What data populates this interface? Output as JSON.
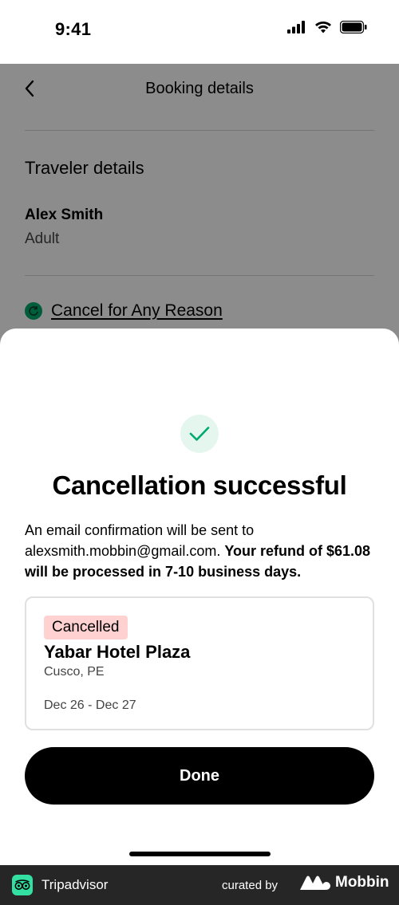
{
  "status_bar": {
    "time": "9:41"
  },
  "nav": {
    "title": "Booking details"
  },
  "traveler": {
    "section_title": "Traveler details",
    "name": "Alex Smith",
    "type": "Adult"
  },
  "cancel_link": "Cancel for Any Reason",
  "sheet": {
    "title": "Cancellation successful",
    "message_prefix": "An email confirmation will be sent to alexsmith.mobbin@gmail.com. ",
    "message_bold": "Your refund of $61.08 will be processed in 7-10 business days.",
    "booking": {
      "status": "Cancelled",
      "hotel": "Yabar Hotel Plaza",
      "location": "Cusco, PE",
      "dates": "Dec 26 - Dec 27"
    },
    "done_label": "Done"
  },
  "footer": {
    "brand": "Tripadvisor",
    "curated_by": "curated by",
    "curator": "Mobbin"
  },
  "colors": {
    "accent_green": "#00aa6c",
    "success_bg": "#e4f6ee",
    "badge_bg": "#ffd1d1",
    "footer_bg": "#262626",
    "tripadvisor_green": "#34e0a1"
  },
  "icons": [
    "signal-icon",
    "wifi-icon",
    "battery-icon",
    "back-chevron-icon",
    "refund-icon",
    "checkmark-icon",
    "tripadvisor-logo-icon",
    "mobbin-logo-icon"
  ]
}
